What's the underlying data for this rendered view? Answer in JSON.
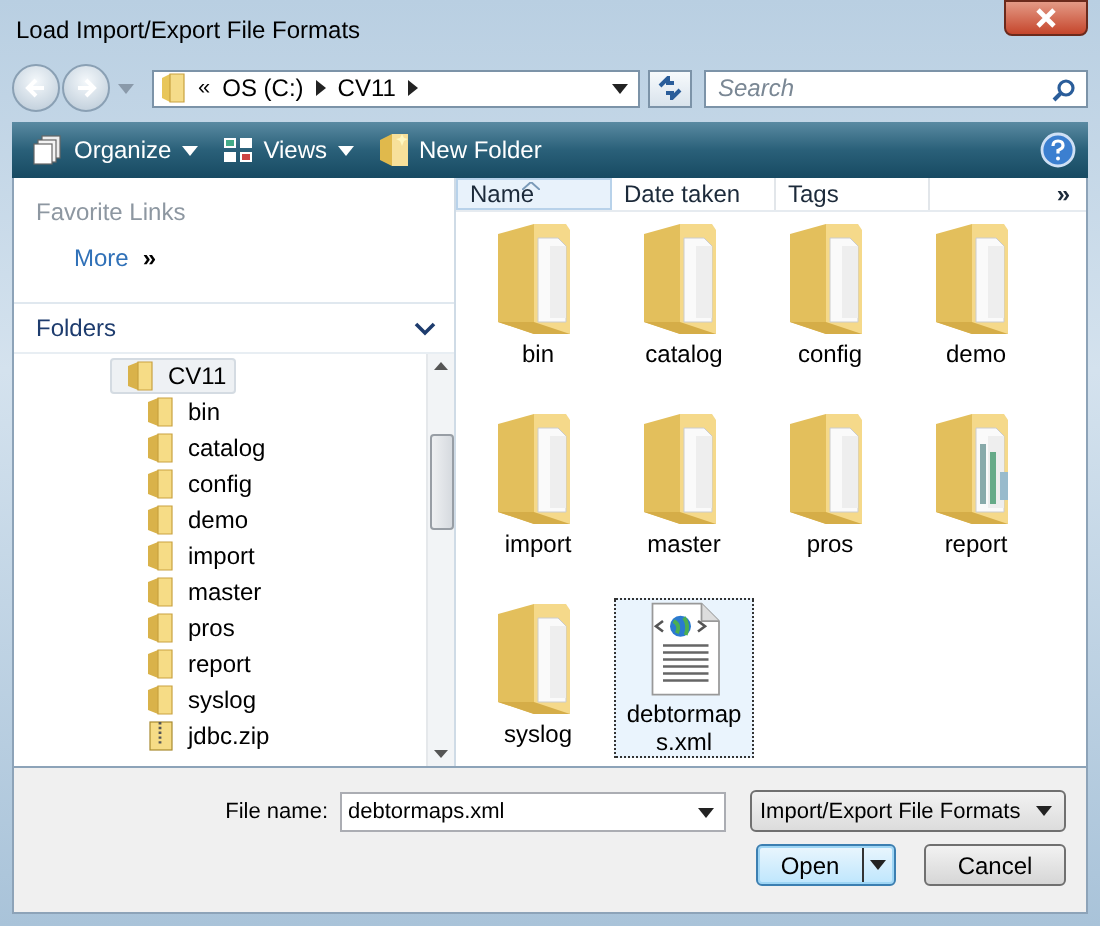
{
  "window": {
    "title": "Load Import/Export File Formats"
  },
  "address": {
    "overflow": "«",
    "path": [
      "OS (C:)",
      "CV11"
    ]
  },
  "search": {
    "placeholder": "Search"
  },
  "toolbar": [
    {
      "label": "Organize",
      "kind": "menu"
    },
    {
      "label": "Views",
      "kind": "menu"
    },
    {
      "label": "New Folder",
      "kind": "action"
    }
  ],
  "favorite_links": {
    "title": "Favorite Links",
    "more": "More",
    "more_glyph": "»"
  },
  "folders": {
    "title": "Folders",
    "tree": [
      {
        "label": "CV11",
        "kind": "folder",
        "selected": true,
        "children": [
          {
            "label": "bin",
            "kind": "folder",
            "selected": false
          },
          {
            "label": "catalog",
            "kind": "folder",
            "selected": false
          },
          {
            "label": "config",
            "kind": "folder",
            "selected": false
          },
          {
            "label": "demo",
            "kind": "folder",
            "selected": false
          },
          {
            "label": "import",
            "kind": "folder",
            "selected": false
          },
          {
            "label": "master",
            "kind": "folder",
            "selected": false
          },
          {
            "label": "pros",
            "kind": "folder",
            "selected": false
          },
          {
            "label": "report",
            "kind": "folder",
            "selected": false
          },
          {
            "label": "syslog",
            "kind": "folder",
            "selected": false
          },
          {
            "label": "jdbc.zip",
            "kind": "zip",
            "selected": false
          }
        ]
      }
    ]
  },
  "columns": [
    {
      "label": "Name",
      "sorted": true
    },
    {
      "label": "Date taken",
      "sorted": false
    },
    {
      "label": "Tags",
      "sorted": false
    }
  ],
  "columns_overflow": "»",
  "items": [
    {
      "name": "bin",
      "kind": "folder",
      "selected": false
    },
    {
      "name": "catalog",
      "kind": "folder",
      "selected": false
    },
    {
      "name": "config",
      "kind": "folder",
      "selected": false
    },
    {
      "name": "demo",
      "kind": "folder",
      "selected": false
    },
    {
      "name": "import",
      "kind": "folder",
      "selected": false
    },
    {
      "name": "master",
      "kind": "folder",
      "selected": false
    },
    {
      "name": "pros",
      "kind": "folder",
      "selected": false
    },
    {
      "name": "report",
      "kind": "folder_full",
      "selected": false
    },
    {
      "name": "syslog",
      "kind": "folder",
      "selected": false
    },
    {
      "name": "debtormaps.xml",
      "kind": "xml",
      "selected": true
    }
  ],
  "file_name": {
    "label": "File name:",
    "value": "debtormaps.xml"
  },
  "filter": {
    "value": "Import/Export File Formats"
  },
  "buttons": [
    {
      "label": "Open",
      "default": true,
      "split": true
    },
    {
      "label": "Cancel",
      "default": false,
      "split": false
    }
  ]
}
